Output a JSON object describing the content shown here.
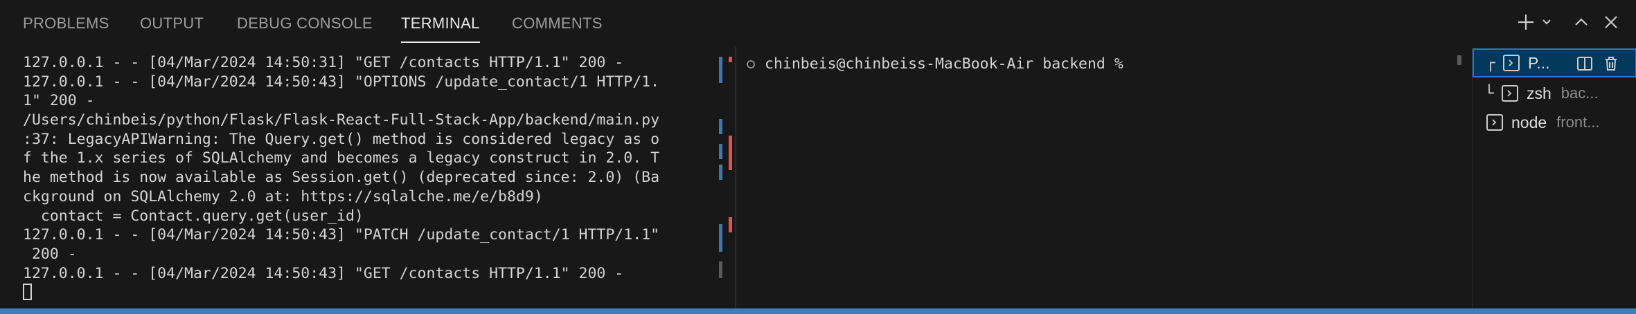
{
  "panel": {
    "tabs": [
      {
        "label": "PROBLEMS"
      },
      {
        "label": "OUTPUT"
      },
      {
        "label": "DEBUG CONSOLE"
      },
      {
        "label": "TERMINAL"
      },
      {
        "label": "COMMENTS"
      }
    ],
    "active_tab": "TERMINAL",
    "actions": [
      "plus-icon",
      "chevron-down-icon",
      "chevron-up-icon",
      "close-icon"
    ]
  },
  "terminal_left": {
    "lines": [
      "127.0.0.1 - - [04/Mar/2024 14:50:31] \"GET /contacts HTTP/1.1\" 200 -",
      "127.0.0.1 - - [04/Mar/2024 14:50:43] \"OPTIONS /update_contact/1 HTTP/1.",
      "1\" 200 -",
      "/Users/chinbeis/python/Flask/Flask-React-Full-Stack-App/backend/main.py",
      ":37: LegacyAPIWarning: The Query.get() method is considered legacy as o",
      "f the 1.x series of SQLAlchemy and becomes a legacy construct in 2.0. T",
      "he method is now available as Session.get() (deprecated since: 2.0) (Ba",
      "ckground on SQLAlchemy 2.0 at: https://sqlalche.me/e/b8d9)",
      "  contact = Contact.query.get(user_id)",
      "127.0.0.1 - - [04/Mar/2024 14:50:43] \"PATCH /update_contact/1 HTTP/1.1\"",
      " 200 -",
      "127.0.0.1 - - [04/Mar/2024 14:50:43] \"GET /contacts HTTP/1.1\" 200 -"
    ]
  },
  "terminal_right": {
    "prompt": "chinbeis@chinbeiss-MacBook-Air backend %"
  },
  "terminal_list": {
    "items": [
      {
        "name": "P...",
        "desc": "",
        "icon": "terminal-icon",
        "tree": "┌"
      },
      {
        "name": "zsh",
        "desc": "bac...",
        "icon": "terminal-icon",
        "tree": "└"
      },
      {
        "name": "node",
        "desc": "front...",
        "icon": "terminal-icon",
        "tree": ""
      }
    ],
    "item_actions": [
      "split-icon",
      "trash-icon"
    ]
  },
  "colors": {
    "background": "#181818",
    "accent": "#3c7fbd",
    "selection": "#04395e",
    "marker_blue": "#3b7ab8",
    "marker_red": "#e05252"
  }
}
